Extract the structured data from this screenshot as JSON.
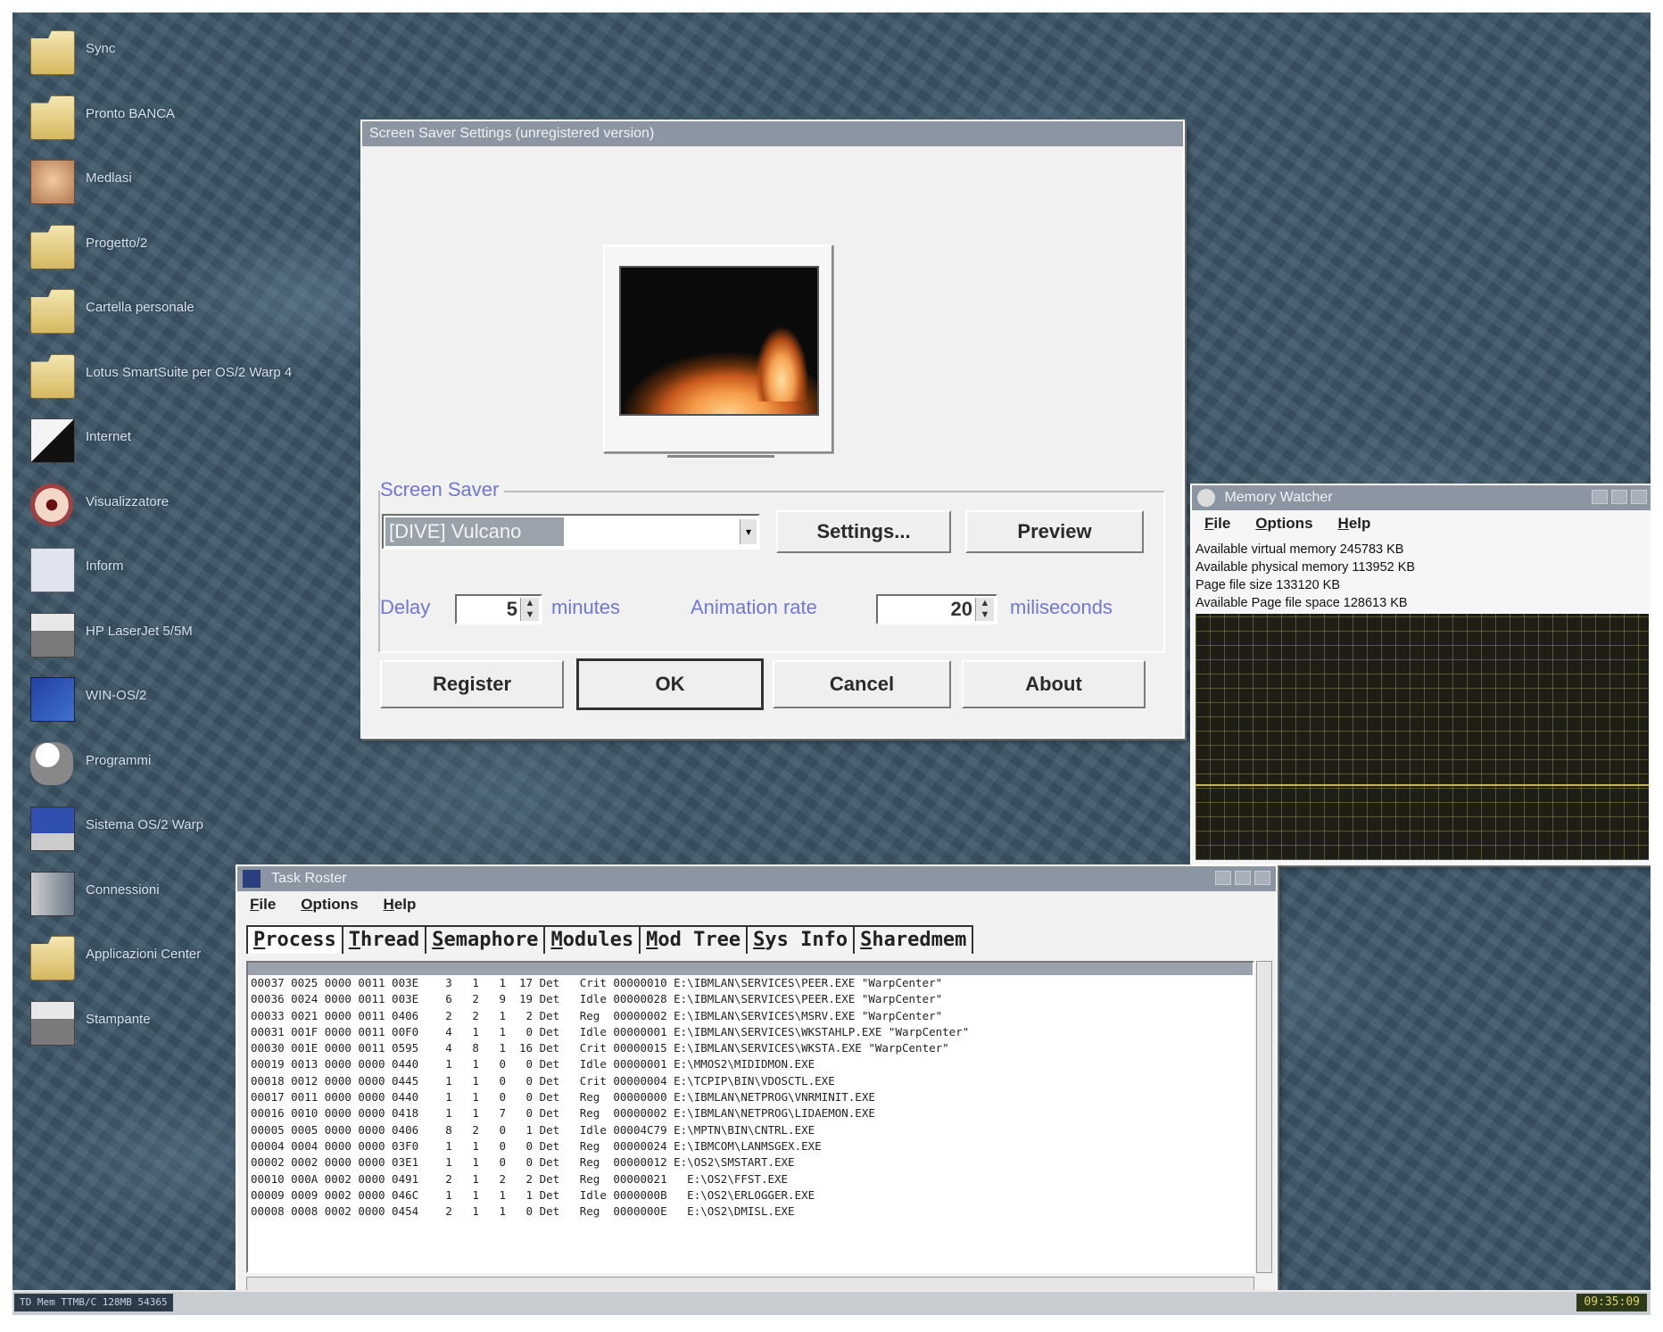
{
  "desktop": {
    "icons": [
      {
        "label": "Sync",
        "icon": "folder-icon"
      },
      {
        "label": "Pronto BANCA",
        "icon": "folder-icon"
      },
      {
        "label": "Medlasi",
        "icon": "face-icon"
      },
      {
        "label": "Progetto/2",
        "icon": "folder-icon"
      },
      {
        "label": "Cartella personale",
        "icon": "folder-icon"
      },
      {
        "label": "Lotus SmartSuite per OS/2 Warp 4",
        "icon": "folder-icon"
      },
      {
        "label": "Internet",
        "icon": "internet-icon"
      },
      {
        "label": "Visualizzatore",
        "icon": "eye-icon"
      },
      {
        "label": "Inform",
        "icon": "document-icon"
      },
      {
        "label": "HP LaserJet 5/5M",
        "icon": "printer-icon"
      },
      {
        "label": "WIN-OS/2",
        "icon": "windows-icon"
      },
      {
        "label": "Programmi",
        "icon": "tools-icon"
      },
      {
        "label": "Sistema OS/2 Warp",
        "icon": "computer-icon"
      },
      {
        "label": "Connessioni",
        "icon": "network-icon"
      },
      {
        "label": "Applicazioni Center",
        "icon": "folder-icon"
      },
      {
        "label": "Stampante",
        "icon": "printer-icon"
      }
    ]
  },
  "screensaver": {
    "title": "Screen Saver Settings (unregistered version)",
    "group_label": "Screen Saver",
    "selected_module": "[DIVE] Vulcano",
    "settings_label": "Settings...",
    "preview_label": "Preview",
    "delay_label": "Delay",
    "delay_value": "5",
    "delay_unit": "minutes",
    "anim_label": "Animation rate",
    "anim_value": "20",
    "anim_unit": "miliseconds",
    "register_label": "Register",
    "ok_label": "OK",
    "cancel_label": "Cancel",
    "about_label": "About"
  },
  "memory_watcher": {
    "title": "Memory Watcher",
    "menu": [
      "File",
      "Options",
      "Help"
    ],
    "stats": [
      "Available virtual memory 245783 KB",
      "Available physical memory 113952 KB",
      "Page file size 133120 KB",
      "Available Page file space 128613 KB"
    ]
  },
  "task_roster": {
    "title": "Task Roster",
    "menu": [
      "File",
      "Options",
      "Help"
    ],
    "tabs": [
      "Process",
      "Thread",
      "Semaphore",
      "Modules",
      "Mod Tree",
      "Sys Info",
      "Sharedmem"
    ],
    "rows": [
      "00037 0025 0000 0011 003E    3   1   1  17 Det   Crit 00000010 E:\\IBMLAN\\SERVICES\\PEER.EXE \"WarpCenter\"",
      "00036 0024 0000 0011 003E    6   2   9  19 Det   Idle 00000028 E:\\IBMLAN\\SERVICES\\PEER.EXE \"WarpCenter\"",
      "00033 0021 0000 0011 0406    2   2   1   2 Det   Reg  00000002 E:\\IBMLAN\\SERVICES\\MSRV.EXE \"WarpCenter\"",
      "00031 001F 0000 0011 00F0    4   1   1   0 Det   Idle 00000001 E:\\IBMLAN\\SERVICES\\WKSTAHLP.EXE \"WarpCenter\"",
      "00030 001E 0000 0011 0595    4   8   1  16 Det   Crit 00000015 E:\\IBMLAN\\SERVICES\\WKSTA.EXE \"WarpCenter\"",
      "00019 0013 0000 0000 0440    1   1   0   0 Det   Idle 00000001 E:\\MMOS2\\MIDIDMON.EXE",
      "00018 0012 0000 0000 0445    1   1   0   0 Det   Crit 00000004 E:\\TCPIP\\BIN\\VDOSCTL.EXE",
      "00017 0011 0000 0000 0440    1   1   0   0 Det   Reg  00000000 E:\\IBMLAN\\NETPROG\\VNRMINIT.EXE",
      "00016 0010 0000 0000 0418    1   1   7   0 Det   Reg  00000002 E:\\IBMLAN\\NETPROG\\LIDAEMON.EXE",
      "00005 0005 0000 0000 0406    8   2   0   1 Det   Idle 00004C79 E:\\MPTN\\BIN\\CNTRL.EXE",
      "00004 0004 0000 0000 03F0    1   1   0   0 Det   Reg  00000024 E:\\IBMCOM\\LANMSGEX.EXE",
      "00002 0002 0000 0000 03E1    1   1   0   0 Det   Reg  00000012 E:\\OS2\\SMSTART.EXE",
      "00010 000A 0002 0000 0491    2   1   2   2 Det   Reg  00000021   E:\\OS2\\FFST.EXE",
      "00009 0009 0002 0000 046C    1   1   1   1 Det   Idle 0000000B   E:\\OS2\\ERLOGGER.EXE",
      "00008 0008 0002 0000 0454    2   1   1   0 Det   Reg  0000000E   E:\\OS2\\DMISL.EXE"
    ]
  },
  "taskbar": {
    "left_text": "TD Mem TTMB/C 128MB 54365",
    "clock": "09:35:09"
  },
  "colors": {
    "desktop": "#3d5668",
    "label_blue": "#7077d6",
    "graph_bg": "#1e1e16",
    "graph_line": "#c9b64a"
  }
}
